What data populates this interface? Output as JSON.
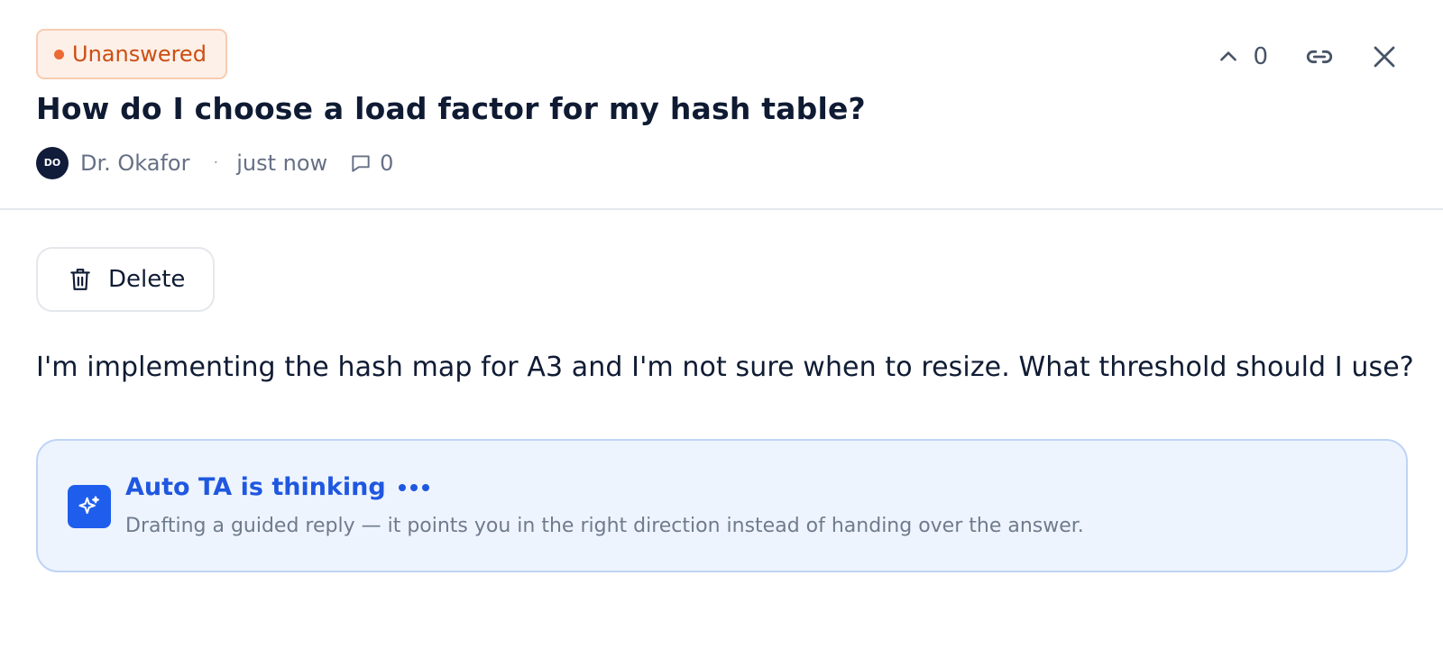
{
  "status": {
    "label": "Unanswered",
    "dot_color": "#ec6a33"
  },
  "question": {
    "title": "How do I choose a load factor for my hash table?",
    "body": "I'm implementing the hash map for A3 and I'm not sure when to resize. What threshold should I use?"
  },
  "meta": {
    "avatar_initials": "DO",
    "author": "Dr. Okafor",
    "separator": "·",
    "time": "just now",
    "comment_count": "0",
    "comment_icon": "comment-icon"
  },
  "actions": {
    "upvote_count": "0",
    "upvote_icon": "chevron-up-icon",
    "link_icon": "link-icon",
    "close_icon": "close-icon"
  },
  "delete_button": {
    "label": "Delete",
    "icon": "trash-icon"
  },
  "ai_card": {
    "title": "Auto TA is thinking",
    "subtitle": "Drafting a guided reply — it points you in the right direction instead of handing over the answer.",
    "icon": "sparkle-icon",
    "accent": "#1f5eed"
  }
}
